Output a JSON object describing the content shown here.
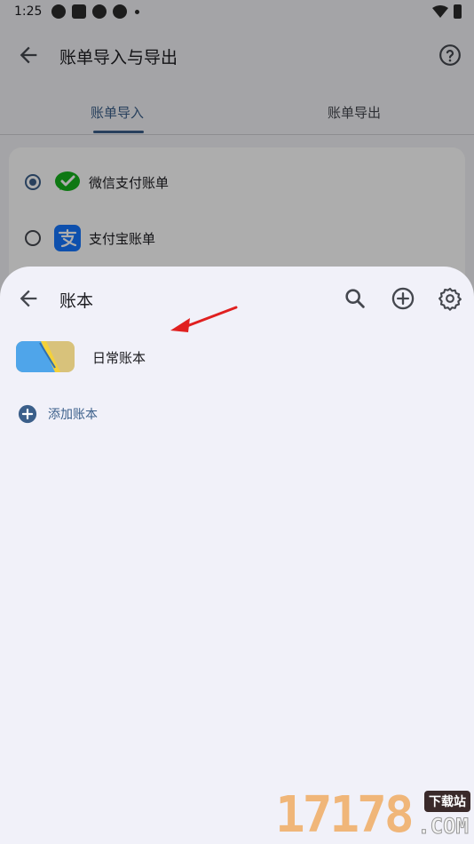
{
  "status_bar": {
    "time": "1:25"
  },
  "app_bar": {
    "title": "账单导入与导出",
    "back_icon": "arrow-left-icon",
    "help_icon": "help-circle-icon"
  },
  "tabs": [
    {
      "label": "账单导入",
      "active": true
    },
    {
      "label": "账单导出",
      "active": false
    }
  ],
  "import_options": [
    {
      "label": "微信支付账单",
      "selected": true,
      "icon": "wechat-pay-icon",
      "color": "#16b11d"
    },
    {
      "label": "支付宝账单",
      "selected": false,
      "icon": "alipay-icon",
      "color": "#1677ff"
    }
  ],
  "sheet": {
    "title": "账本",
    "actions": [
      "search-icon",
      "add-circle-icon",
      "gear-icon"
    ],
    "books": [
      {
        "name": "日常账本"
      }
    ],
    "add_label": "添加账本"
  },
  "watermark": {
    "digits": "17178",
    "badge": "下载站",
    "suffix": ".COM"
  },
  "colors": {
    "accent": "#3b5f8a",
    "sheet_bg": "#f1f1f9",
    "annotation": "#e02020"
  }
}
